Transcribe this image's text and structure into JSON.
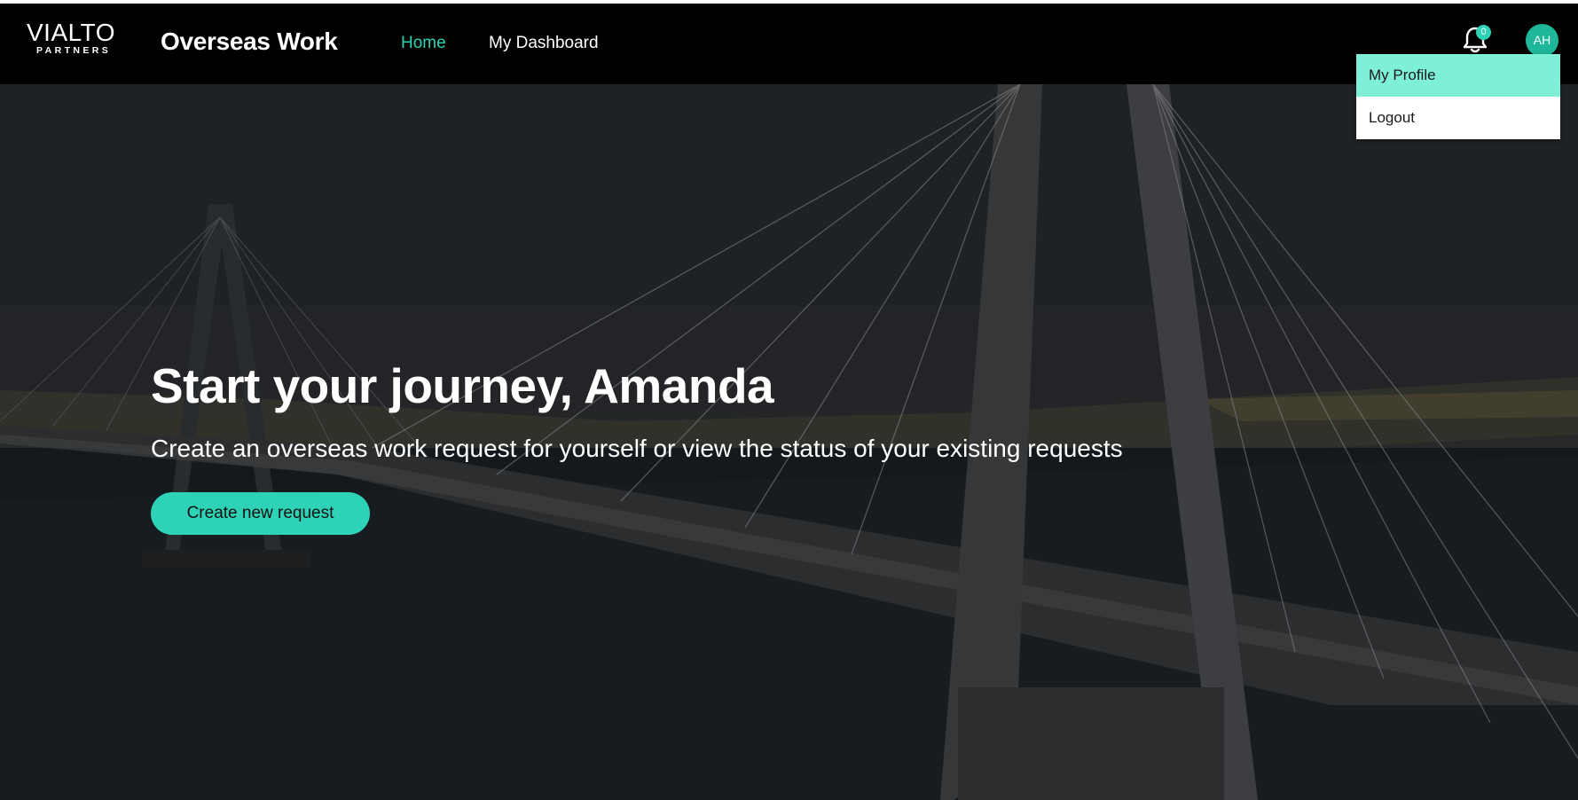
{
  "header": {
    "logo_main": "VIALTO",
    "logo_sub": "PARTNERS",
    "app_title": "Overseas Work",
    "nav": {
      "home": "Home",
      "dashboard": "My Dashboard"
    },
    "notifications_count": "0",
    "avatar_initials": "AH"
  },
  "user_menu": {
    "profile": "My Profile",
    "logout": "Logout"
  },
  "hero": {
    "title": "Start your journey, Amanda",
    "subtitle": "Create an overseas work request for yourself or view the status of your existing requests",
    "cta": "Create new request"
  },
  "colors": {
    "accent": "#2ed3b7",
    "menu_highlight": "#7ef0d7",
    "header_bg": "#000000"
  },
  "icons": {
    "notifications": "bell-icon"
  }
}
